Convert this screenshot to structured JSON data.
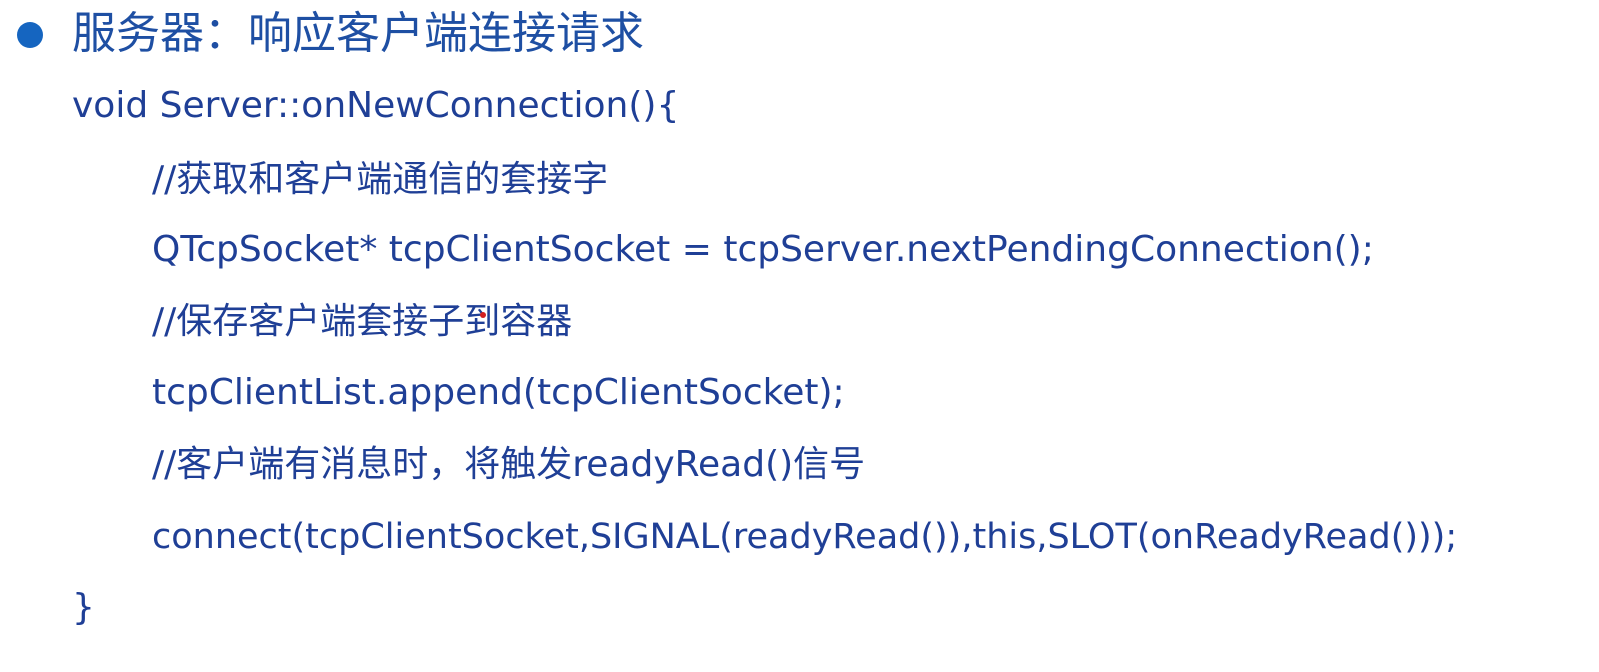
{
  "heading": "服务器：响应客户端连接请求",
  "code_lines": [
    "void Server::onNewConnection(){",
    "//获取和客户端通信的套接字",
    "QTcpSocket* tcpClientSocket = tcpServer.nextPendingConnection();",
    "//保存客户端套接子到容器",
    "tcpClientList.append(tcpClientSocket);",
    "//客户端有消息时，将触发readyRead()信号",
    "connect(tcpClientSocket,SIGNAL(readyRead()),this,SLOT(onReadyRead()));",
    "}"
  ],
  "colors": {
    "text": "#1f3f96",
    "bullet": "#1565c0",
    "cursor": "#d21f1f"
  }
}
